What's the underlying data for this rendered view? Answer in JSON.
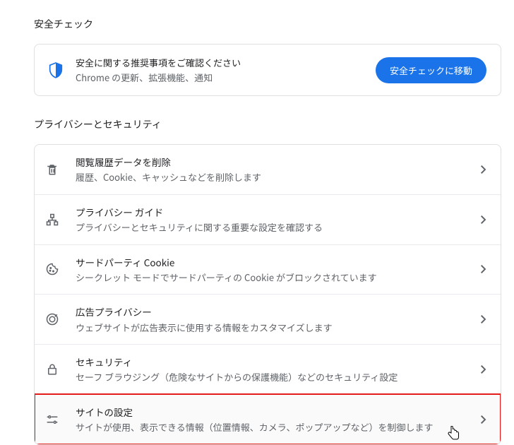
{
  "safety_check": {
    "heading": "安全チェック",
    "primary": "安全に関する推奨事項をご確認ください",
    "secondary": "Chrome の更新、拡張機能、通知",
    "button_label": "安全チェックに移動"
  },
  "privacy": {
    "heading": "プライバシーとセキュリティ",
    "items": [
      {
        "icon": "trash-icon",
        "primary": "閲覧履歴データを削除",
        "secondary": "履歴、Cookie、キャッシュなどを削除します"
      },
      {
        "icon": "guide-icon",
        "primary": "プライバシー ガイド",
        "secondary": "プライバシーとセキュリティに関する重要な設定を確認する"
      },
      {
        "icon": "cookie-icon",
        "primary": "サードパーティ Cookie",
        "secondary": "シークレット モードでサードパーティの Cookie がブロックされています"
      },
      {
        "icon": "ad-icon",
        "primary": "広告プライバシー",
        "secondary": "ウェブサイトが広告表示に使用する情報をカスタマイズします"
      },
      {
        "icon": "lock-icon",
        "primary": "セキュリティ",
        "secondary": "セーフ ブラウジング（危険なサイトからの保護機能）などのセキュリティ設定"
      },
      {
        "icon": "tune-icon",
        "primary": "サイトの設定",
        "secondary": "サイトが使用、表示できる情報（位置情報、カメラ、ポップアップなど）を制御します",
        "highlighted": true
      }
    ]
  }
}
